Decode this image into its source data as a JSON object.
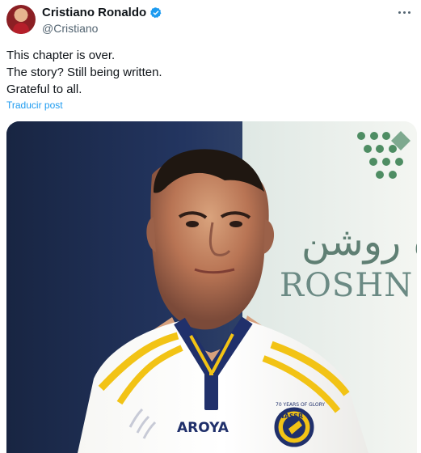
{
  "profile": {
    "name": "Cristiano Ronaldo",
    "handle": "@Cristiano"
  },
  "post": {
    "lines": [
      "This chapter is over.",
      "The story? Still being written.",
      "Grateful to all."
    ],
    "translate_label": "Traducir post"
  },
  "image": {
    "banner_arabic": "ة روشن",
    "banner_latin": "ROSHN C",
    "shirt_sponsor": "AROYA",
    "badge_text": "NASSR",
    "badge_arc_text": "70 YEARS OF GLORY"
  },
  "colors": {
    "verified_blue": "#1d9bf0",
    "link_blue": "#1d9bf0",
    "kit_blue": "#20306b",
    "kit_yellow": "#f2c315"
  },
  "icons": {
    "verified": "verified-badge-icon",
    "more": "more-icon"
  }
}
